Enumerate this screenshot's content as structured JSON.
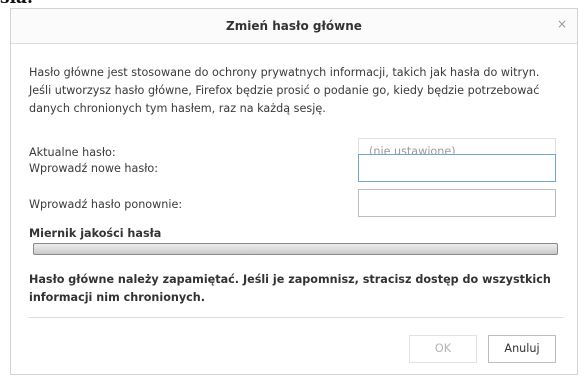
{
  "page_fragment": "sia.",
  "dialog": {
    "title": "Zmień hasło główne",
    "close_symbol": "×",
    "description": "Hasło główne jest stosowane do ochrony prywatnych informacji, takich jak hasła do witryn. Jeśli utworzysz hasło główne, Firefox będzie prosić o podanie go, kiedy będzie potrzebować danych chronionych tym hasłem, raz na każdą sesję.",
    "fields": {
      "current_label": "Aktualne hasło:",
      "current_value": "(nie ustawione)",
      "new_label": "Wprowadź nowe hasło:",
      "new_value": "",
      "repeat_label": "Wprowadź hasło ponownie:",
      "repeat_value": ""
    },
    "meter": {
      "label": "Miernik jakości hasła",
      "level": 0
    },
    "warning": "Hasło główne należy zapamiętać. Jeśli je zapomnisz, stracisz dostęp do wszystkich informacji nim chronionych.",
    "buttons": {
      "ok": "OK",
      "cancel": "Anuluj"
    },
    "colors": {
      "focus_border": "#6fa9c9",
      "disabled_text": "#9b9b9b"
    }
  }
}
